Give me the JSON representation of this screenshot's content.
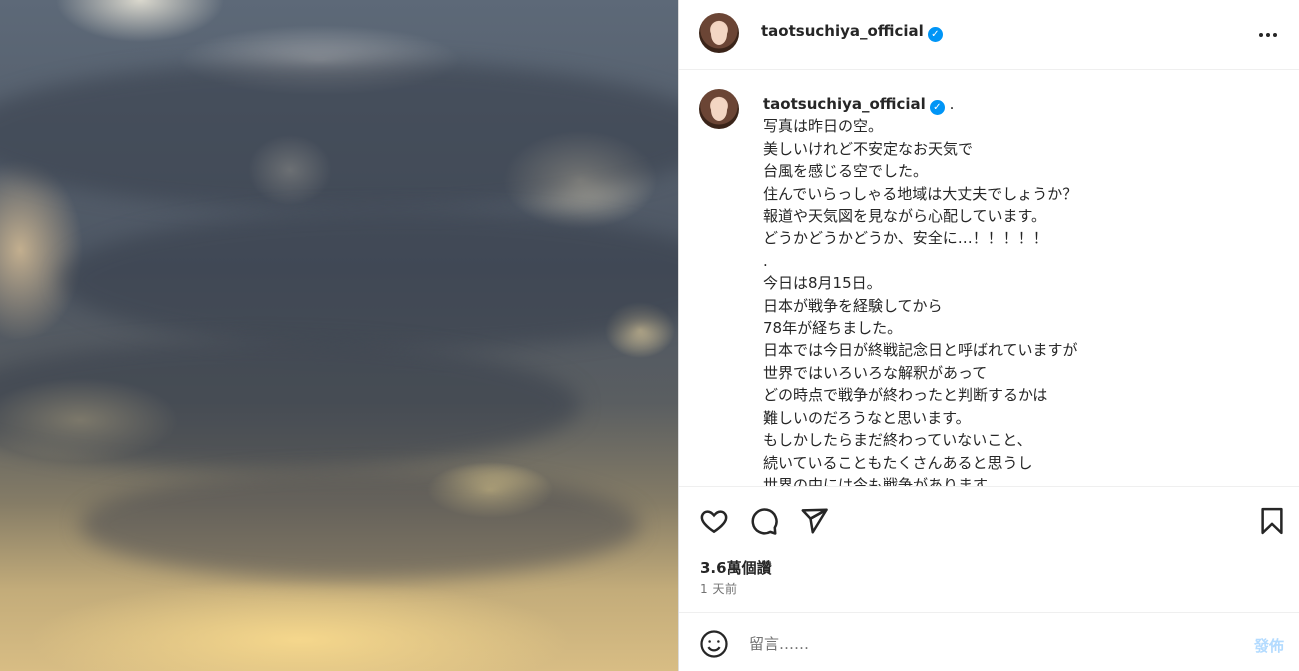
{
  "post": {
    "image_alt": "",
    "username": "taotsuchiya_official",
    "verified_icon": "verified-badge-icon",
    "more_icon": "more-options-icon"
  },
  "caption": {
    "username": "taotsuchiya_official",
    "suffix": ".",
    "text": "写真は昨日の空。\n美しいけれど不安定なお天気で\n台風を感じる空でした。\n住んでいらっしゃる地域は大丈夫でしょうか？\n報道や天気図を見ながら心配しています。\nどうかどうかどうか、安全に…！！！！！\n.\n今日は8月15日。\n日本が戦争を経験してから\n78年が経ちました。\n日本では今日が終戦記念日と呼ばれていますが\n世界ではいろいろな解釈があって\nどの時点で戦争が終わったと判断するかは\n難しいのだろうなと思います。\nもしかしたらまだ終わっていないこと、\n続いていることもたくさんあると思うし\n世界の中には今も戦争があります"
  },
  "actions": {
    "like_icon": "heart-icon",
    "comment_icon": "comment-icon",
    "share_icon": "send-icon",
    "save_icon": "bookmark-icon"
  },
  "stats": {
    "likes": "3.6萬個讚",
    "time": "1 天前"
  },
  "comment": {
    "placeholder": "留言……",
    "post_label": "發佈",
    "emoji_icon": "emoji-icon"
  },
  "colors": {
    "verified": "#0095f6",
    "post_button_disabled": "#b3dbff",
    "secondary_text": "#737373"
  }
}
